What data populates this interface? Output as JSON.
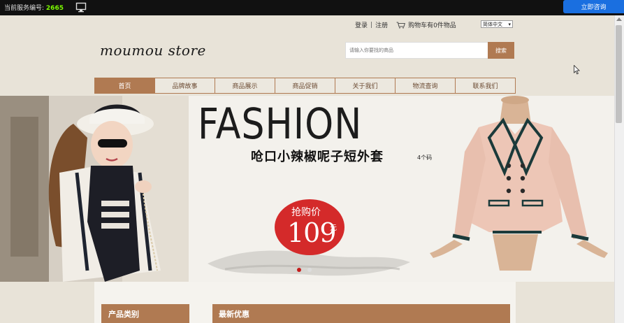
{
  "topbar": {
    "code_label": "当前服务编号:",
    "code_value": "2665",
    "consult_button": "立即咨询",
    "monitor_icon": "monitor-icon"
  },
  "header": {
    "links": {
      "login": "登录",
      "separator": "|",
      "register": "注册",
      "cart": "购物车有0件物品"
    },
    "cart_icon": "cart-icon",
    "language": "简体中文",
    "logo": "moumou  store",
    "search": {
      "placeholder": "请输入你要找的商品",
      "button": "搜索"
    }
  },
  "nav": {
    "items": [
      {
        "label": "首页",
        "active": true
      },
      {
        "label": "品牌故事",
        "active": false
      },
      {
        "label": "商品展示",
        "active": false
      },
      {
        "label": "商品促销",
        "active": false
      },
      {
        "label": "关于我们",
        "active": false
      },
      {
        "label": "物流查询",
        "active": false
      },
      {
        "label": "联系我们",
        "active": false
      }
    ]
  },
  "banner": {
    "headline": "FASHION",
    "subtitle": "呛口小辣椒呢子短外套",
    "subtitle_note": "4个码",
    "price_label": "抢购价",
    "price": "109",
    "price_unit": "元",
    "slide_count": 2,
    "active_slide": 1
  },
  "sections": {
    "categories": "产品类别",
    "new_arrivals": "最新优惠"
  },
  "colors": {
    "accent": "#b07a52",
    "page_bg": "#e8e3d8",
    "topbar_bg": "#111111",
    "consult_btn": "#1a6fe0",
    "price_badge": "#d42a2a"
  }
}
